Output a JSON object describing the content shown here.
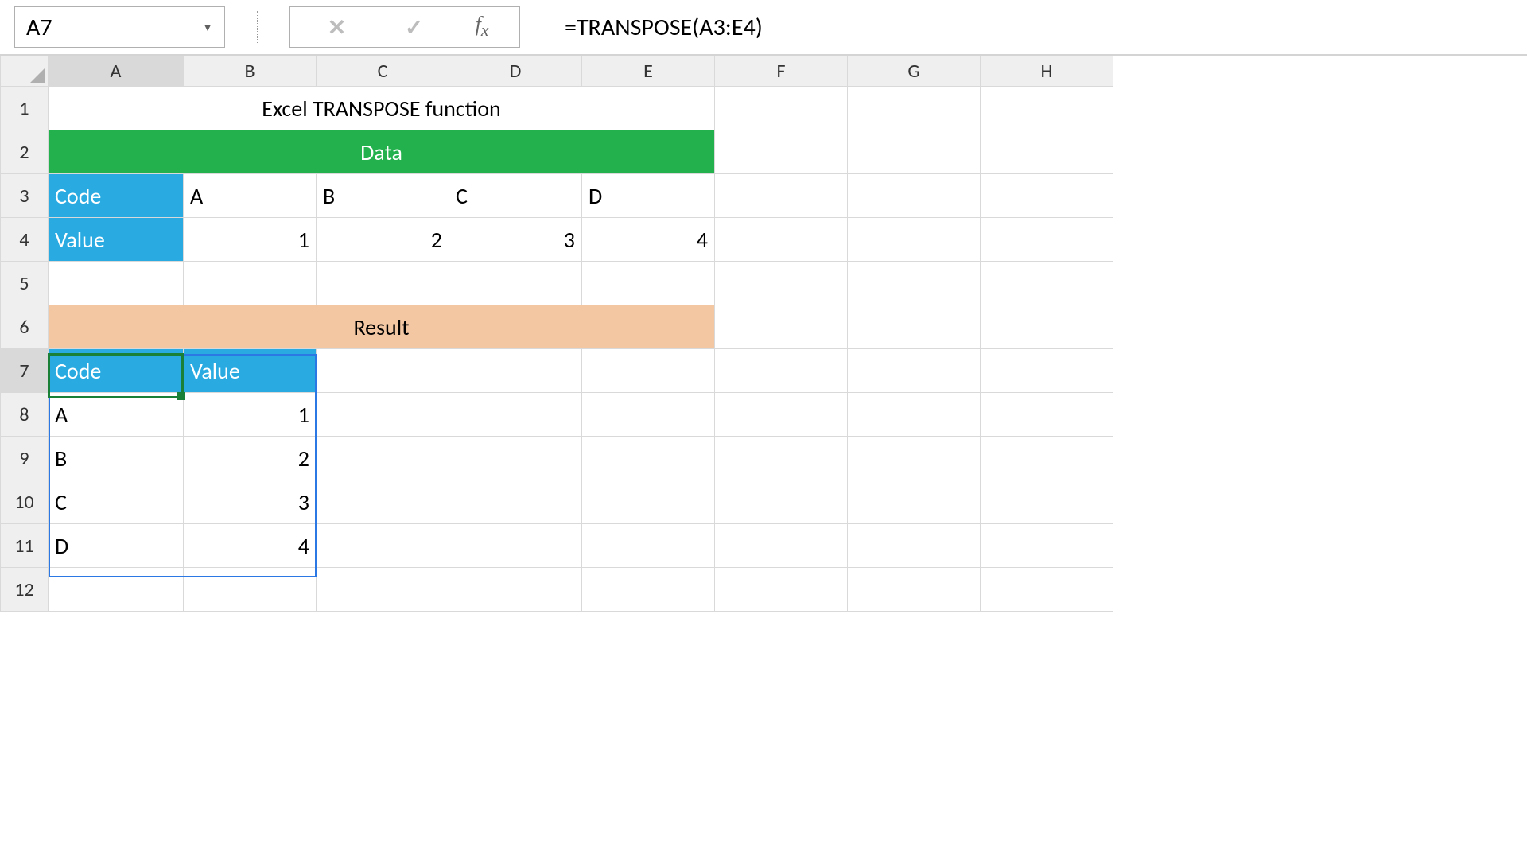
{
  "nameBox": "A7",
  "formula": "=TRANSPOSE(A3:E4)",
  "columns": [
    "A",
    "B",
    "C",
    "D",
    "E",
    "F",
    "G",
    "H"
  ],
  "rows": [
    "1",
    "2",
    "3",
    "4",
    "5",
    "6",
    "7",
    "8",
    "9",
    "10",
    "11",
    "12"
  ],
  "cells": {
    "title": "Excel TRANSPOSE function",
    "dataHeader": "Data",
    "resultHeader": "Result",
    "labels": {
      "code": "Code",
      "value": "Value"
    },
    "sourceRow1": {
      "b": "A",
      "c": "B",
      "d": "C",
      "e": "D"
    },
    "sourceRow2": {
      "b": "1",
      "c": "2",
      "d": "3",
      "e": "4"
    },
    "resultHeaders": {
      "a": "Code",
      "b": "Value"
    },
    "resultRows": [
      {
        "a": "A",
        "b": "1"
      },
      {
        "a": "B",
        "b": "2"
      },
      {
        "a": "C",
        "b": "3"
      },
      {
        "a": "D",
        "b": "4"
      }
    ]
  },
  "chart_data": {
    "type": "table",
    "title": "Excel TRANSPOSE function",
    "input": {
      "headers": [
        "Code",
        "Value"
      ],
      "orientation": "rows",
      "data": [
        [
          "A",
          "B",
          "C",
          "D"
        ],
        [
          1,
          2,
          3,
          4
        ]
      ]
    },
    "output": {
      "headers": [
        "Code",
        "Value"
      ],
      "orientation": "columns",
      "data": [
        [
          "A",
          1
        ],
        [
          "B",
          2
        ],
        [
          "C",
          3
        ],
        [
          "D",
          4
        ]
      ]
    },
    "formula": "=TRANSPOSE(A3:E4)"
  }
}
